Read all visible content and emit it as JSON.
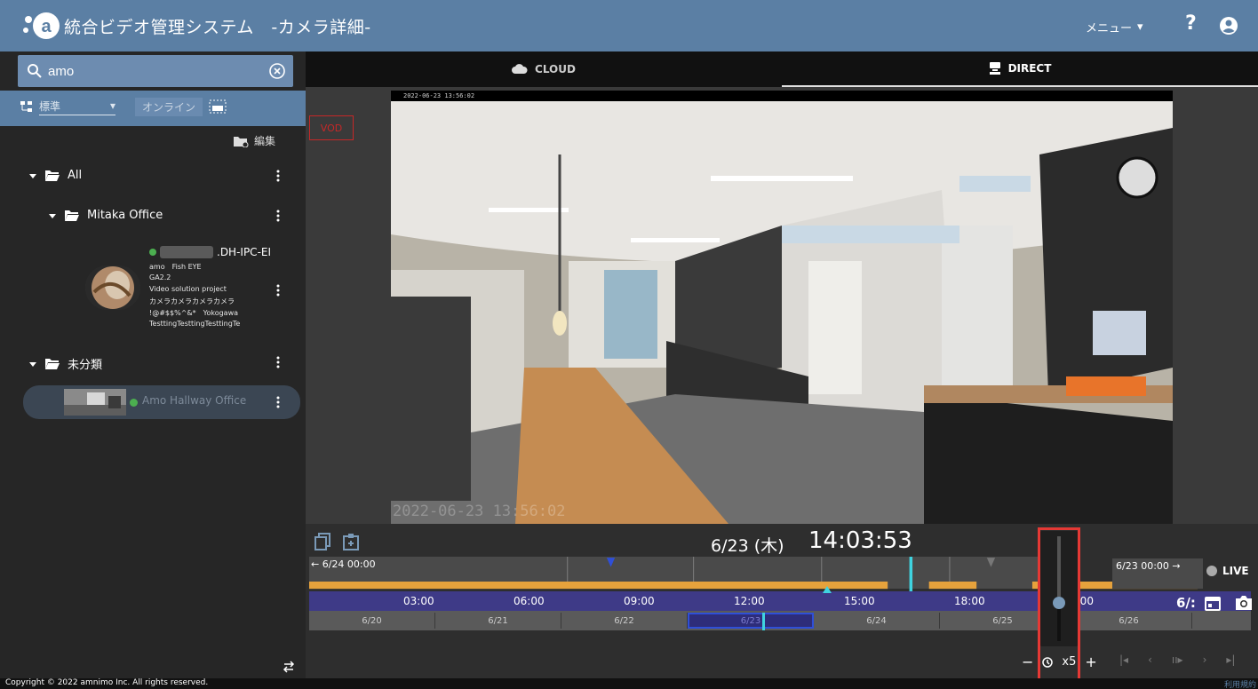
{
  "header": {
    "app_title": "統合ビデオ管理システム　-カメラ詳細-",
    "menu_label": "メニュー",
    "help_label": "?"
  },
  "sidebar": {
    "search": {
      "value": "amo",
      "placeholder": ""
    },
    "filter": {
      "tree_type": "標準",
      "online_label": "オンライン"
    },
    "edit_label": "編集",
    "tree": {
      "root": "All",
      "office_group": "Mitaka Office",
      "camera": {
        "name_suffix": ".DH-IPC-EI",
        "lines": [
          "amo　Fish EYE",
          "GA2.2",
          "Video solution project",
          "カメラカメラカメラカメラ",
          "!@#$$%^&*　Yokogawa",
          "TesttingTesttingTesttingTe"
        ]
      },
      "uncategorized": "未分類",
      "selected_camera": "Amo Hallway Office"
    }
  },
  "main": {
    "tabs": [
      {
        "label": "CLOUD",
        "icon": "cloud-icon",
        "active": false
      },
      {
        "label": "DIRECT",
        "icon": "camera-device-icon",
        "active": true
      }
    ],
    "vod_label": "VOD",
    "video": {
      "timestamp_top": "2022-06-23 13:56:02",
      "timestamp_bottom": "2022-06-23 13:56:02"
    },
    "player": {
      "date": "6/23 (木)",
      "time": "14:03:53",
      "timeline_prev": "← 6/24 00:00",
      "timeline_next": "6/23 00:00 →",
      "hours": [
        "03:00",
        "06:00",
        "09:00",
        "12:00",
        "15:00",
        "18:00",
        "1:00"
      ],
      "days": [
        "6/20",
        "6/21",
        "6/22",
        "6/23",
        "6/24",
        "6/25",
        "6/26"
      ],
      "current_day": "6/23",
      "live_label": "LIVE",
      "date_short": "6/:",
      "speed": "x5",
      "speed_minus": "−",
      "speed_plus": "+",
      "slider_level": 0.42
    }
  },
  "footer": {
    "copyright": "Copyright © 2022 amnimo Inc. All rights reserved.",
    "terms": "利用規約"
  },
  "colors": {
    "header": "#5b7fa4",
    "timeline_recording": "#e6a23c",
    "hours_bar": "#3e3a87",
    "highlight": "#e53935",
    "online": "#4caf50"
  }
}
